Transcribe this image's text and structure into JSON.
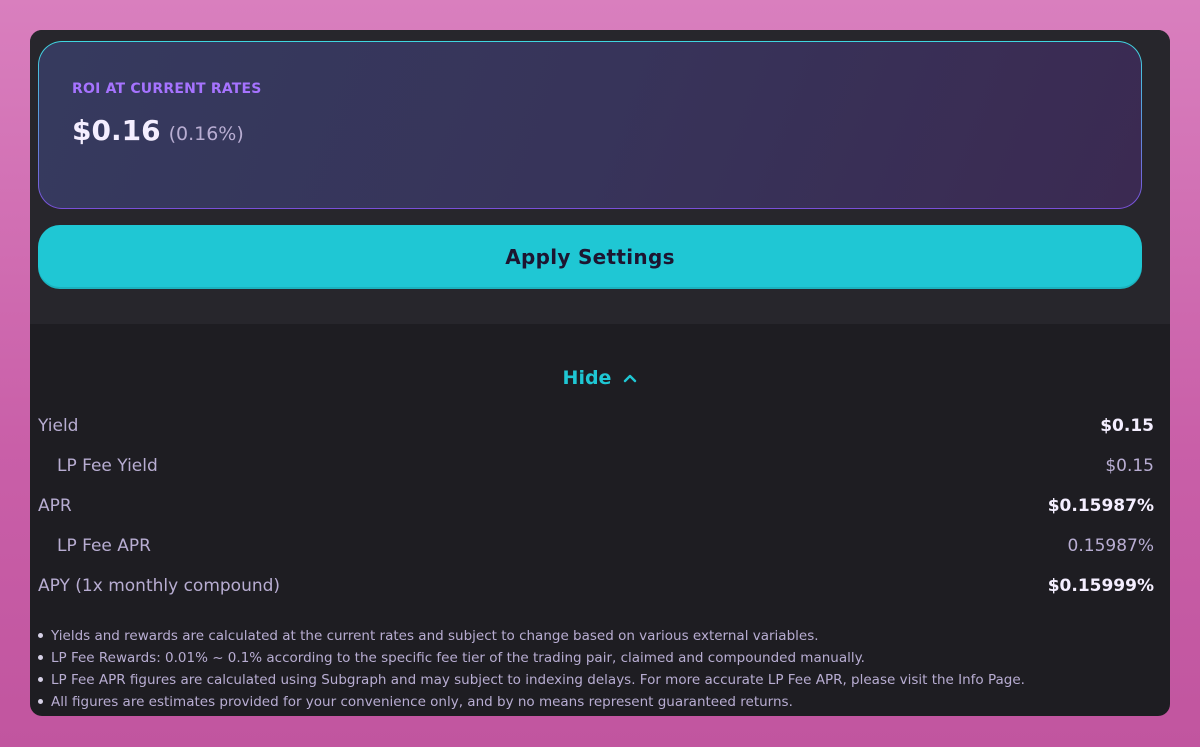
{
  "roi": {
    "label": "ROI AT CURRENT RATES",
    "amount": "$0.16",
    "percent": "(0.16%)"
  },
  "apply_button": "Apply Settings",
  "toggle": {
    "label": "Hide",
    "icon": "chevron-up-icon"
  },
  "details": {
    "rows": [
      {
        "label": "Yield",
        "value": "$0.15"
      },
      {
        "label": "LP Fee Yield",
        "value": "$0.15"
      },
      {
        "label": "APR",
        "value": "$0.15987%"
      },
      {
        "label": "LP Fee APR",
        "value": "0.15987%"
      },
      {
        "label": "APY (1x monthly compound)",
        "value": "$0.15999%"
      }
    ]
  },
  "notes": [
    "Yields and rewards are calculated at the current rates and subject to change based on various external variables.",
    "LP Fee Rewards: 0.01% ~ 0.1% according to the specific fee tier of the trading pair, claimed and compounded manually.",
    "LP Fee APR figures are calculated using Subgraph and may subject to indexing delays. For more accurate LP Fee APR, please visit the Info Page.",
    "All figures are estimates provided for your convenience only, and by no means represent guaranteed returns."
  ],
  "colors": {
    "accent": "#1fc7d4",
    "label_purple": "#a673ff",
    "text_secondary": "#b8add2",
    "text_primary": "#f4eeff",
    "panel": "#1e1d22"
  }
}
